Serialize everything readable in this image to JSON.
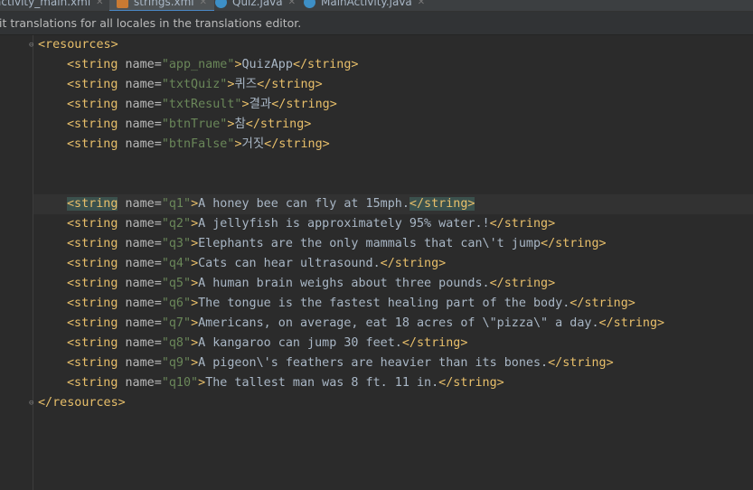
{
  "tabs": [
    {
      "label": "activity_main.xml",
      "icon": "xml-file-icon"
    },
    {
      "label": "strings.xml",
      "icon": "xml-file-icon",
      "active": true
    },
    {
      "label": "Quiz.java",
      "icon": "java-class-icon"
    },
    {
      "label": "MainActivity.java",
      "icon": "java-class-icon"
    }
  ],
  "banner": {
    "text": "it translations for all locales in the translations editor."
  },
  "code": {
    "open_root": "<resources>",
    "close_root": "</resources>",
    "open_tag": "<string",
    "close_tag": "</string>",
    "attr": "name=",
    "gt": ">",
    "entries": [
      {
        "name": "\"app_name\"",
        "value": "QuizApp"
      },
      {
        "name": "\"txtQuiz\"",
        "value": "퀴즈"
      },
      {
        "name": "\"txtResult\"",
        "value": "결과"
      },
      {
        "name": "\"btnTrue\"",
        "value": "참"
      },
      {
        "name": "\"btnFalse\"",
        "value": "거짓"
      },
      {
        "name": "\"q1\"",
        "value": "A honey bee can fly at 15mph."
      },
      {
        "name": "\"q2\"",
        "value": "A jellyfish is approximately 95% water.!"
      },
      {
        "name": "\"q3\"",
        "value": "Elephants are the only mammals that can\\'t jump"
      },
      {
        "name": "\"q4\"",
        "value": "Cats can hear ultrasound."
      },
      {
        "name": "\"q5\"",
        "value": "A human brain weighs about three pounds."
      },
      {
        "name": "\"q6\"",
        "value": "The tongue is the fastest healing part of the body."
      },
      {
        "name": "\"q7\"",
        "value": "Americans, on average, eat 18 acres of \\\"pizza\\\" a day."
      },
      {
        "name": "\"q8\"",
        "value": "A kangaroo can jump 30 feet."
      },
      {
        "name": "\"q9\"",
        "value": "A pigeon\\'s feathers are heavier than its bones."
      },
      {
        "name": "\"q10\"",
        "value": "The tallest man was 8 ft. 11 in."
      }
    ]
  },
  "colors": {
    "background": "#2b2b2b",
    "tag": "#e8bf6a",
    "attribute_value": "#6a8759",
    "text": "#a9b7c6"
  }
}
